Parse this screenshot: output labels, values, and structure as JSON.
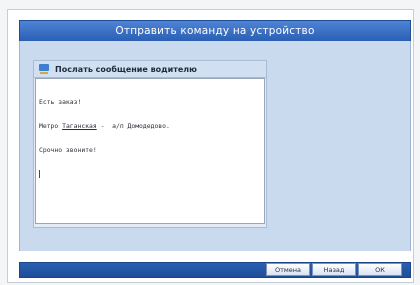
{
  "window": {
    "title": "Отправить команду на устройство"
  },
  "panel": {
    "title": "Послать сообщение водителю"
  },
  "message": {
    "line1": "Есть заказ!",
    "line2_prefix": "Метро ",
    "line2_station": "Таганская",
    "line2_suffix": " -  а/п Домодедово.",
    "line3": "Срочно звоните!"
  },
  "buttons": {
    "cancel": "Отмена",
    "back": "Назад",
    "ok": "ОК"
  }
}
